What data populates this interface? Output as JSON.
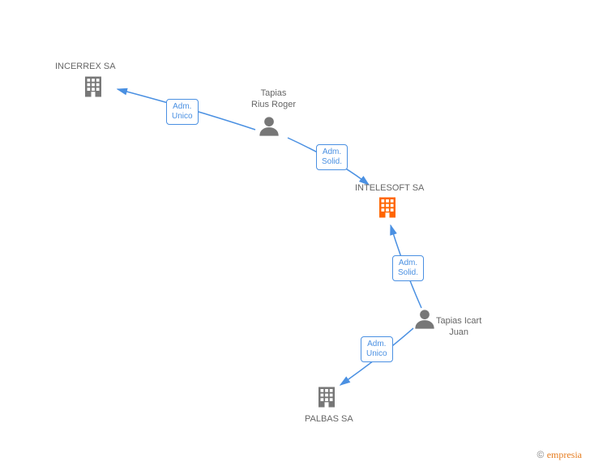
{
  "nodes": {
    "incerrex": {
      "label": "INCERREX SA"
    },
    "intelesoft": {
      "label": "INTELESOFT SA"
    },
    "palbas": {
      "label": "PALBAS SA"
    },
    "tapias_rius": {
      "line1": "Tapias",
      "line2": "Rius Roger"
    },
    "tapias_icart": {
      "line1": "Tapias Icart",
      "line2": "Juan"
    }
  },
  "edges": {
    "rius_incerrex": {
      "line1": "Adm.",
      "line2": "Unico"
    },
    "rius_intelesoft": {
      "line1": "Adm.",
      "line2": "Solid."
    },
    "icart_intelesoft": {
      "line1": "Adm.",
      "line2": "Solid."
    },
    "icart_palbas": {
      "line1": "Adm.",
      "line2": "Unico"
    }
  },
  "footer": {
    "copyright": "©",
    "brand": "empresia"
  }
}
